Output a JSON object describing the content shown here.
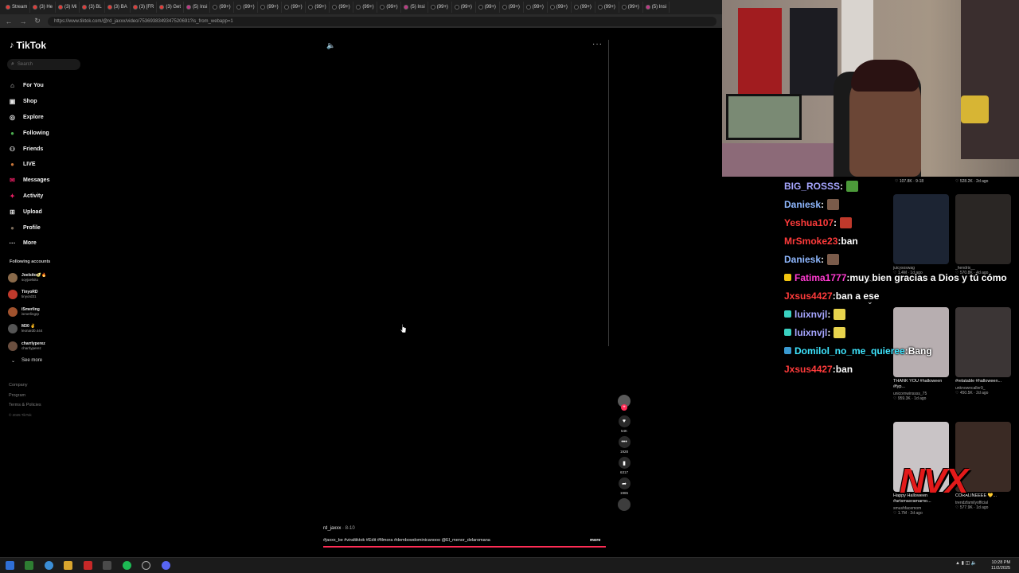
{
  "browser": {
    "tabs": [
      "Stream",
      "(3) He",
      "(3) Mi",
      "(3) BL",
      "(3) BA",
      "(3) [FR",
      "(3) Get",
      "(5) Insi",
      "(99+) ",
      "(99+) ",
      "(99+) ",
      "(99+) ",
      "(99+) ",
      "(99+) ",
      "(99+) ",
      "(99+) ",
      "(5) Insi",
      "(99+) ",
      "(99+) ",
      "(99+) ",
      "(99+) ",
      "(99+) ",
      "(99+) ",
      "(99+) ",
      "(99+) ",
      "(99+) ",
      "(5) Insi"
    ],
    "url": "https://www.tiktok.com/@rd_jaxxx/video/7536938349347520691?is_from_webapp=1"
  },
  "sidebar": {
    "logo": "TikTok",
    "search_placeholder": "Search",
    "nav": [
      {
        "label": "For You",
        "icon": "home-icon"
      },
      {
        "label": "Shop",
        "icon": "shop-icon"
      },
      {
        "label": "Explore",
        "icon": "compass-icon"
      },
      {
        "label": "Following",
        "icon": "following-icon"
      },
      {
        "label": "Friends",
        "icon": "friends-icon"
      },
      {
        "label": "LIVE",
        "icon": "live-icon"
      },
      {
        "label": "Messages",
        "icon": "messages-icon"
      },
      {
        "label": "Activity",
        "icon": "activity-icon"
      },
      {
        "label": "Upload",
        "icon": "upload-icon"
      },
      {
        "label": "Profile",
        "icon": "profile-icon"
      },
      {
        "label": "More",
        "icon": "more-icon"
      }
    ],
    "following_title": "Following accounts",
    "accounts": [
      {
        "name": "Joelsito🥑🔥",
        "handle": "soyjoelsito"
      },
      {
        "name": "TinyoRD",
        "handle": "tinyord31"
      },
      {
        "name": "iSmerling",
        "handle": "ismerlingrp"
      },
      {
        "name": "M30 ✌",
        "handle": "leonard0.444"
      },
      {
        "name": "charrlyperez",
        "handle": "charrlyperez"
      }
    ],
    "see_more": "See more",
    "footer": [
      "Company",
      "Program",
      "Terms & Policies"
    ],
    "copyright": "© 2025 TikTok"
  },
  "video": {
    "author": "rd_jaxxx",
    "date": "· 8-10",
    "caption": "#jaxxx_be #viraltiktok #Edit #filmora #dembowdominicanooo @El_menor_delaromana",
    "more_label": "more",
    "progress": 1.0,
    "actions": [
      {
        "name": "like",
        "count": "54K"
      },
      {
        "name": "comment",
        "count": "1928"
      },
      {
        "name": "save",
        "count": "6317"
      },
      {
        "name": "share",
        "count": "1965"
      }
    ]
  },
  "chat": [
    {
      "user": "BIG_ROSSS",
      "color": "#a6a6ff",
      "text": "",
      "emote": "#4c9a3a",
      "badge": ""
    },
    {
      "user": "Daniesk",
      "color": "#8fb8ff",
      "text": "",
      "emote": "#7a5b4a",
      "badge": ""
    },
    {
      "user": "Yeshua107",
      "color": "#ff3b3b",
      "text": "",
      "emote": "#c0392b",
      "badge": ""
    },
    {
      "user": "MrSmoke23",
      "color": "#ff3b3b",
      "text": "ban",
      "emote": "",
      "badge": ""
    },
    {
      "user": "Daniesk",
      "color": "#8fb8ff",
      "text": "",
      "emote": "#7a5b4a",
      "badge": ""
    },
    {
      "user": "Fatima1777",
      "color": "#ff3bd0",
      "text": "muy bien gracias a Dios y tú cómo",
      "emote": "",
      "badge": "#f1c40f"
    },
    {
      "user": "Jxsus4427",
      "color": "#ff3b3b",
      "text": "ban a ese",
      "emote": "",
      "badge": ""
    },
    {
      "user": "luixnvjl",
      "color": "#a6a6ff",
      "text": "",
      "emote": "#e8d44d",
      "badge": "#3ad1c1"
    },
    {
      "user": "luixnvjl",
      "color": "#a6a6ff",
      "text": "",
      "emote": "#e8d44d",
      "badge": "#3ad1c1"
    },
    {
      "user": "Domilol_no_me_quieree",
      "color": "#3ee6ff",
      "text": "Bang",
      "emote": "",
      "badge": "#3a9ad1"
    },
    {
      "user": "Jxsus4427",
      "color": "#ff3b3b",
      "text": "ban",
      "emote": "",
      "badge": ""
    }
  ],
  "grid": {
    "top_stats": [
      "♡ 107.8K · 9-18",
      "♡ 528.2K · 2d ago"
    ],
    "cards": [
      {
        "title": "",
        "user": "juicysoswag",
        "stat": "♡ 1.4M · 1d ago",
        "thumb": "#1c2433"
      },
      {
        "title": "",
        "user": "_hendrix__",
        "stat": "♡ 570.8K · 4d ago",
        "thumb": "#2a2624"
      },
      {
        "title": "THANK YOU #halloween #fyp...",
        "user": "unicornwinssss_75",
        "stat": "♡ 959.3K · 1d ago",
        "thumb": "#b7aeb0"
      },
      {
        "title": "#relatable #halloween...",
        "user": "unknowncaller9_",
        "stat": "♡ 450.5K · 2d ago",
        "thumb": "#3b3535"
      },
      {
        "title": "Happy Halloween #artsmasramarno...",
        "user": "smushfacemom",
        "stat": "♡ 1.7M · 2d ago",
        "thumb": "#c9c4c6"
      },
      {
        "title": "CORALINEEEE 💛...",
        "user": "trendzfamilyofficial",
        "stat": "♡ 577.9K · 1d ago",
        "thumb": "#3a2a24"
      }
    ],
    "overlay_text": "NVX"
  },
  "taskbar": {
    "time": "10:28 PM",
    "date": "11/2/2025"
  }
}
